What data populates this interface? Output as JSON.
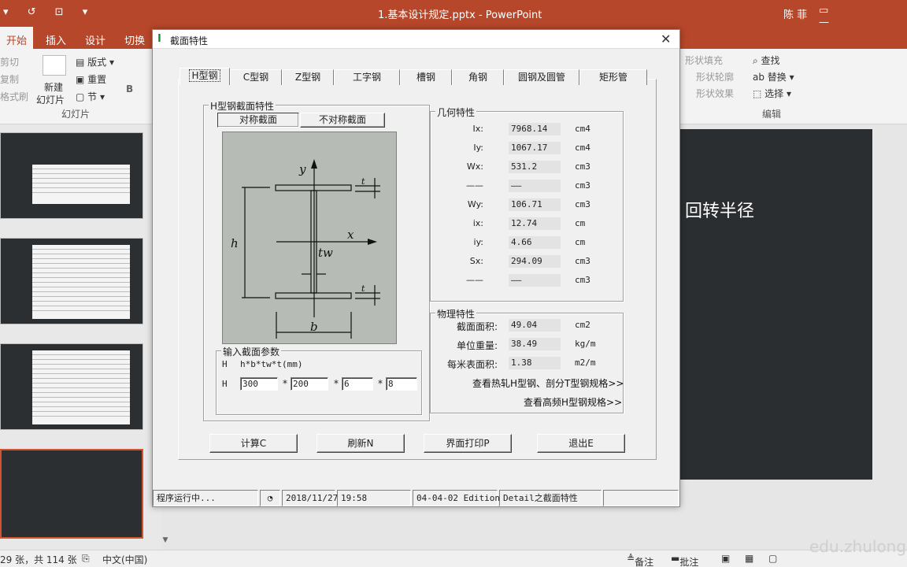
{
  "ppt": {
    "title": "1.基本设计规定.pptx - PowerPoint",
    "user": "陈 菲",
    "tabs": [
      "开始",
      "插入",
      "设计",
      "切换"
    ],
    "ribbon": {
      "cut": "剪切",
      "copy": "复制",
      "format_painter": "格式刷",
      "new_slide": "新建",
      "new_slide2": "幻灯片",
      "layout": "版式",
      "reset": "重置",
      "section": "节",
      "slides_group": "幻灯片",
      "shape_fill": "形状填充",
      "shape_outline": "形状轮廓",
      "shape_effects": "形状效果",
      "find": "查找",
      "replace": "替换",
      "select": "选择",
      "editing_group": "编辑"
    },
    "slide_text": "回转半径",
    "status": {
      "slide_count": "29 张，共 114 张",
      "language": "中文(中国)",
      "notes": "备注",
      "comments": "批注"
    },
    "watermark": "edu.zhulong"
  },
  "dialog": {
    "title": "截面特性",
    "tabs": [
      "H型钢",
      "C型钢",
      "Z型钢",
      "工字钢",
      "槽钢",
      "角钢",
      "圆钢及圆管",
      "矩形管"
    ],
    "section_group": "H型钢截面特性",
    "sym_button": "对称截面",
    "asym_button": "不对称截面",
    "geom_group": "几何特性",
    "geom": [
      {
        "label": "Ix:",
        "value": "7968.14",
        "unit": "cm4"
      },
      {
        "label": "Iy:",
        "value": "1067.17",
        "unit": "cm4"
      },
      {
        "label": "Wx:",
        "value": "531.2",
        "unit": "cm3"
      },
      {
        "label": "——",
        "value": "——",
        "unit": "cm3"
      },
      {
        "label": "Wy:",
        "value": "106.71",
        "unit": "cm3"
      },
      {
        "label": "ix:",
        "value": "12.74",
        "unit": "cm"
      },
      {
        "label": "iy:",
        "value": "4.66",
        "unit": "cm"
      },
      {
        "label": "Sx:",
        "value": "294.09",
        "unit": "cm3"
      },
      {
        "label": "——",
        "value": "——",
        "unit": "cm3"
      }
    ],
    "phys_group": "物理特性",
    "phys": [
      {
        "label": "截面面积:",
        "value": "49.04",
        "unit": "cm2"
      },
      {
        "label": "单位重量:",
        "value": "38.49",
        "unit": "kg/m"
      },
      {
        "label": "每米表面积:",
        "value": "1.38",
        "unit": "m2/m"
      }
    ],
    "link1": "查看热轧H型钢、剖分T型钢规格>>",
    "link2": "查看高频H型钢规格>>",
    "input_group": "输入截面参数",
    "input_prefix": "H",
    "input_formula": "h*b*tw*t(mm)",
    "inputs": [
      "300",
      "200",
      "6",
      "8"
    ],
    "mul": "*",
    "diagram_labels": {
      "y": "y",
      "x": "x",
      "tw": "tw",
      "h": "h",
      "b": "b",
      "t": "t"
    },
    "buttons": [
      "计算C",
      "刷新N",
      "界面打印P",
      "退出E"
    ],
    "status": [
      "程序运行中...",
      "2018/11/27",
      "19:58",
      "04-04-02 Edition",
      "Detail之截面特性"
    ]
  }
}
